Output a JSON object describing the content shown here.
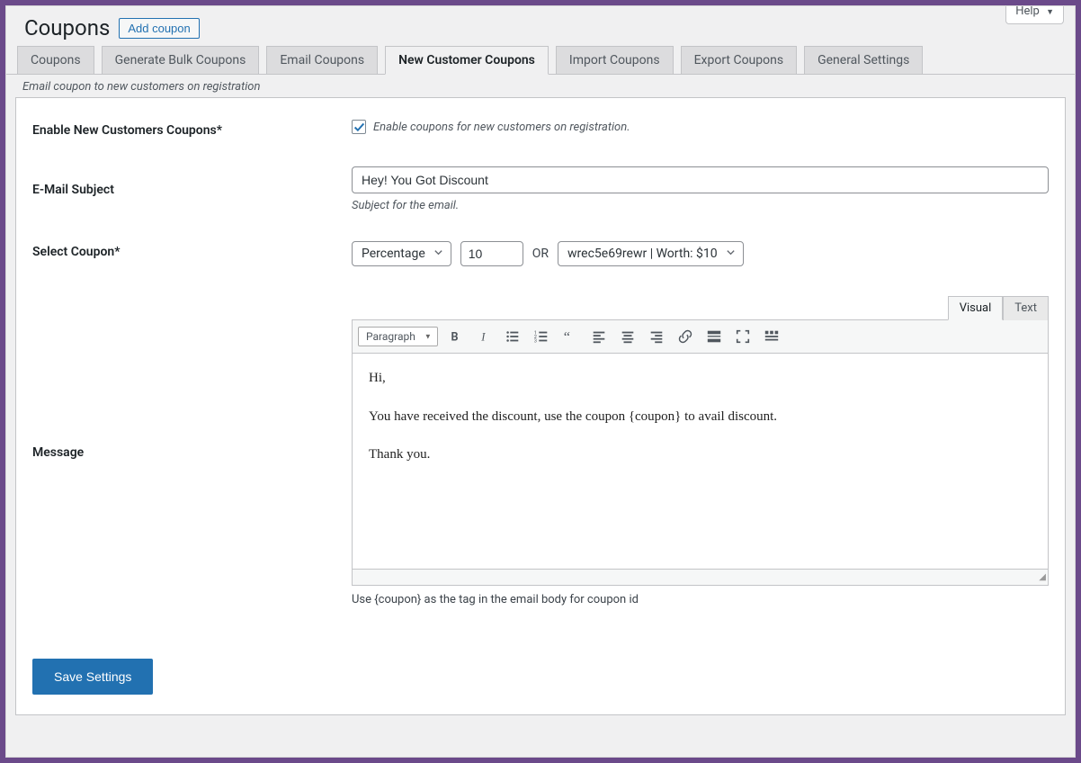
{
  "help_label": "Help",
  "page_title": "Coupons",
  "add_button": "Add coupon",
  "tabs": [
    "Coupons",
    "Generate Bulk Coupons",
    "Email Coupons",
    "New Customer Coupons",
    "Import Coupons",
    "Export Coupons",
    "General Settings"
  ],
  "tab_description": "Email coupon to new customers on registration",
  "enable": {
    "label": "Enable New Customers Coupons*",
    "text": "Enable coupons for new customers on registration."
  },
  "subject": {
    "label": "E-Mail Subject",
    "value": "Hey! You Got Discount",
    "help": "Subject for the email."
  },
  "select_coupon": {
    "label": "Select Coupon*",
    "type_value": "Percentage",
    "amount_value": "10",
    "or_text": "OR",
    "coupon_value": "wrec5e69rewr | Worth: $10"
  },
  "editor_tabs": {
    "visual": "Visual",
    "text": "Text"
  },
  "editor_format": "Paragraph",
  "message": {
    "label": "Message",
    "body": {
      "p1": "Hi,",
      "p2": "You have received the discount, use the coupon {coupon} to avail discount.",
      "p3": "Thank you."
    },
    "help": "Use {coupon} as the tag in the email body for coupon id"
  },
  "save_button": "Save Settings"
}
